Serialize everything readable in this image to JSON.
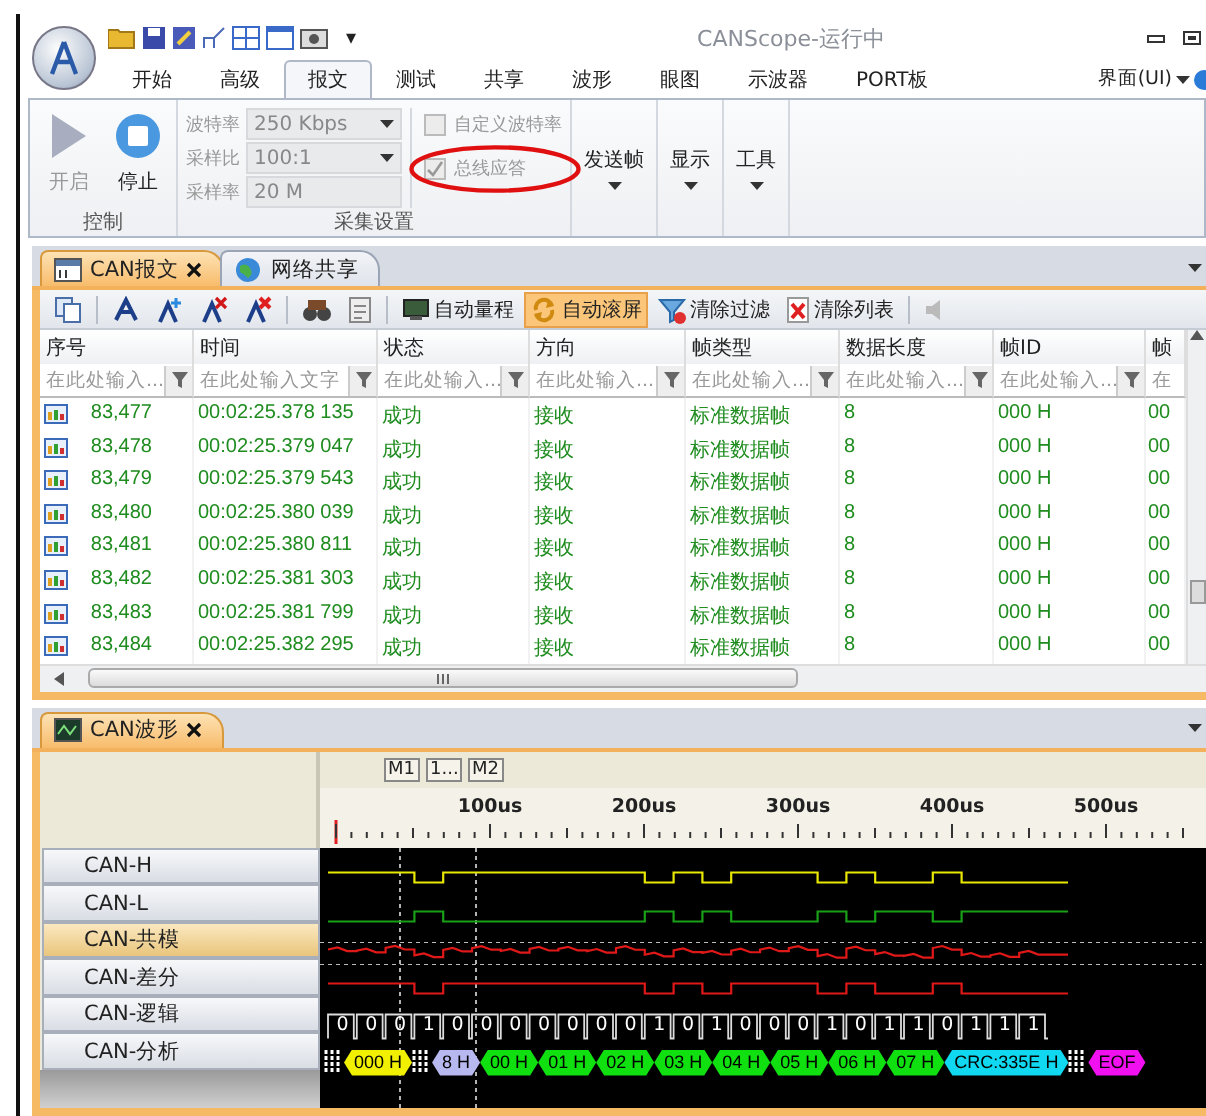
{
  "window": {
    "title": "CANScope-运行中"
  },
  "quick_access": {
    "more": "▾"
  },
  "ribbon_tabs": [
    {
      "label": "开始",
      "selected": false
    },
    {
      "label": "高级",
      "selected": false
    },
    {
      "label": "报文",
      "selected": true
    },
    {
      "label": "测试",
      "selected": false
    },
    {
      "label": "共享",
      "selected": false
    },
    {
      "label": "波形",
      "selected": false
    },
    {
      "label": "眼图",
      "selected": false
    },
    {
      "label": "示波器",
      "selected": false
    },
    {
      "label": "PORT板",
      "selected": false
    }
  ],
  "ui_menu": {
    "label": "界面(UI)"
  },
  "control_group": {
    "title": "控制",
    "buttons": [
      {
        "kind": "start",
        "label": "开启",
        "disabled": true
      },
      {
        "kind": "stop",
        "label": "停止",
        "disabled": false
      }
    ]
  },
  "capture_group": {
    "title": "采集设置",
    "fields": [
      {
        "label": "波特率",
        "value": "250 Kbps",
        "dropdown": true
      },
      {
        "label": "采样比",
        "value": "100:1",
        "dropdown": true
      },
      {
        "label": "采样率",
        "value": "20 M",
        "dropdown": false
      }
    ],
    "checkboxes": [
      {
        "label": "自定义波特率",
        "checked": false,
        "disabled": true
      },
      {
        "label": "总线应答",
        "checked": true,
        "disabled": true
      }
    ],
    "highlighted": true
  },
  "menu_buttons": [
    {
      "label": "发送帧"
    },
    {
      "label": "显示"
    },
    {
      "label": "工具"
    }
  ],
  "doc_tabs": [
    {
      "kind": "table",
      "label": "CAN报文",
      "selected": true,
      "closable": true
    },
    {
      "kind": "globe",
      "label": "网络共享",
      "selected": false,
      "closable": false
    }
  ],
  "toolbar": [
    {
      "kind": "copy"
    },
    {
      "kind": "mark"
    },
    {
      "kind": "mark-add"
    },
    {
      "kind": "mark-del"
    },
    {
      "kind": "mark-clear"
    },
    {
      "kind": "find"
    },
    {
      "kind": "export"
    },
    {
      "kind": "autorange",
      "label": "自动量程",
      "active": false
    },
    {
      "kind": "autoscroll",
      "label": "自动滚屏",
      "active": true
    },
    {
      "kind": "clearfilter",
      "label": "清除过滤",
      "active": false
    },
    {
      "kind": "clearlist",
      "label": "清除列表",
      "active": false
    },
    {
      "kind": "sound"
    }
  ],
  "table": {
    "columns": [
      {
        "label": "序号",
        "placeholder": "在此处输入..."
      },
      {
        "label": "时间",
        "placeholder": "在此处输入文字"
      },
      {
        "label": "状态",
        "placeholder": "在此处输入..."
      },
      {
        "label": "方向",
        "placeholder": "在此处输入..."
      },
      {
        "label": "帧类型",
        "placeholder": "在此处输入..."
      },
      {
        "label": "数据长度",
        "placeholder": "在此处输入..."
      },
      {
        "label": "帧ID",
        "placeholder": "在此处输入..."
      },
      {
        "label": "帧",
        "placeholder": "在"
      }
    ],
    "rows": [
      {
        "cells": [
          "83,477",
          "00:02:25.378 135",
          "成功",
          "接收",
          "标准数据帧",
          "8",
          "000 H",
          "00"
        ]
      },
      {
        "cells": [
          "83,478",
          "00:02:25.379 047",
          "成功",
          "接收",
          "标准数据帧",
          "8",
          "000 H",
          "00"
        ]
      },
      {
        "cells": [
          "83,479",
          "00:02:25.379 543",
          "成功",
          "接收",
          "标准数据帧",
          "8",
          "000 H",
          "00"
        ]
      },
      {
        "cells": [
          "83,480",
          "00:02:25.380 039",
          "成功",
          "接收",
          "标准数据帧",
          "8",
          "000 H",
          "00"
        ]
      },
      {
        "cells": [
          "83,481",
          "00:02:25.380 811",
          "成功",
          "接收",
          "标准数据帧",
          "8",
          "000 H",
          "00"
        ]
      },
      {
        "cells": [
          "83,482",
          "00:02:25.381 303",
          "成功",
          "接收",
          "标准数据帧",
          "8",
          "000 H",
          "00"
        ]
      },
      {
        "cells": [
          "83,483",
          "00:02:25.381 799",
          "成功",
          "接收",
          "标准数据帧",
          "8",
          "000 H",
          "00"
        ]
      },
      {
        "cells": [
          "83,484",
          "00:02:25.382 295",
          "成功",
          "接收",
          "标准数据帧",
          "8",
          "000 H",
          "00"
        ]
      }
    ]
  },
  "wave_tabs": [
    {
      "label": "CAN波形",
      "selected": true,
      "closable": true
    }
  ],
  "markers": [
    "M1",
    "1...",
    "M2"
  ],
  "ruler_labels": [
    "100us",
    "200us",
    "300us",
    "400us",
    "500us"
  ],
  "channels": [
    {
      "kind": "analog",
      "label": "CAN-H",
      "selected": false,
      "color": "#e8e800"
    },
    {
      "kind": "analog-inverted",
      "label": "CAN-L",
      "selected": false,
      "color": "#18a018"
    },
    {
      "kind": "noisy",
      "label": "CAN-共模",
      "selected": true,
      "color": "#e01818"
    },
    {
      "kind": "analog",
      "label": "CAN-差分",
      "selected": false,
      "color": "#e01818"
    },
    {
      "kind": "logic",
      "label": "CAN-逻辑",
      "selected": false,
      "bits": [
        "0",
        "0",
        "0",
        "1",
        "0",
        "0",
        "0",
        "0",
        "0",
        "0",
        "0",
        "1",
        "0",
        "1",
        "0",
        "0",
        "0",
        "1",
        "0",
        "1",
        "1",
        "0",
        "1",
        "1",
        "1"
      ]
    },
    {
      "kind": "decode",
      "label": "CAN-分析",
      "selected": false,
      "segments": [
        {
          "kind": "stuff"
        },
        {
          "kind": "field",
          "text": "000 H",
          "color": "#f0f000"
        },
        {
          "kind": "stuff"
        },
        {
          "kind": "field",
          "text": "8 H",
          "color": "#b8b8f0"
        },
        {
          "kind": "field",
          "text": "00 H",
          "color": "#10e010"
        },
        {
          "kind": "field",
          "text": "01 H",
          "color": "#10e010"
        },
        {
          "kind": "field",
          "text": "02 H",
          "color": "#10e010"
        },
        {
          "kind": "field",
          "text": "03 H",
          "color": "#10e010"
        },
        {
          "kind": "field",
          "text": "04 H",
          "color": "#10e010"
        },
        {
          "kind": "field",
          "text": "05 H",
          "color": "#10e010"
        },
        {
          "kind": "field",
          "text": "06 H",
          "color": "#10e010"
        },
        {
          "kind": "field",
          "text": "07 H",
          "color": "#10e010"
        },
        {
          "kind": "field",
          "text": "CRC:335E H",
          "color": "#10d8f0"
        },
        {
          "kind": "stuff"
        },
        {
          "kind": "field",
          "text": "EOF",
          "color": "#f010f0"
        }
      ]
    }
  ]
}
